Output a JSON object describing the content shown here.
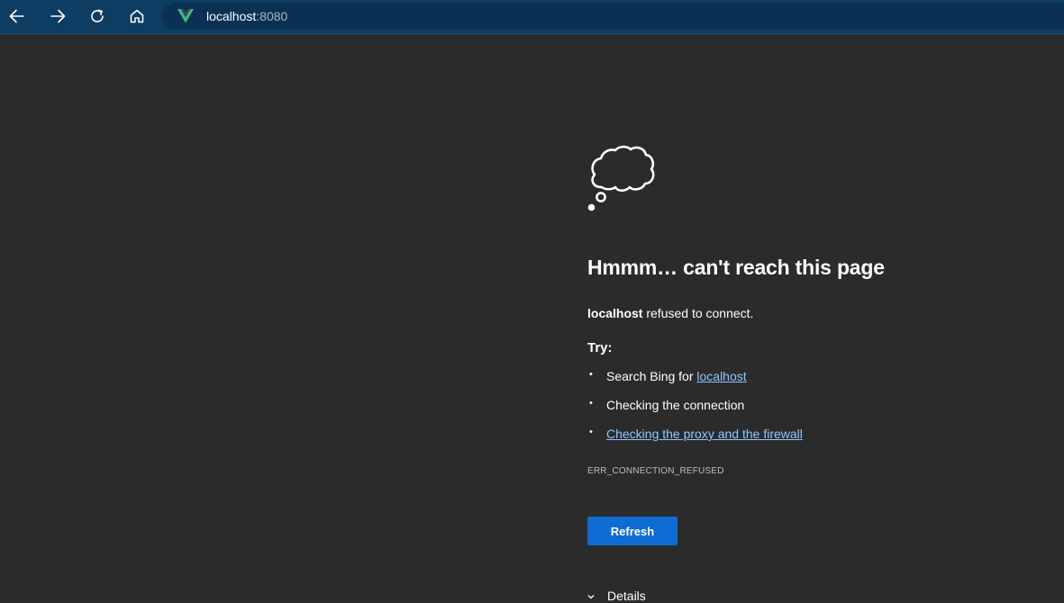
{
  "toolbar": {
    "back_icon": "arrow-left-icon",
    "forward_icon": "arrow-right-icon",
    "refresh_icon": "refresh-icon",
    "home_icon": "home-icon"
  },
  "address": {
    "host": "localhost",
    "port": ":8080",
    "site_icon": "vue-logo-icon"
  },
  "error_page": {
    "icon": "thought-cloud-icon",
    "headline": "Hmmm… can't reach this page",
    "host_bold": "localhost",
    "refused_text": " refused to connect.",
    "try_label": "Try:",
    "suggestions": {
      "bing_prefix": "Search Bing for ",
      "bing_link": "localhost",
      "check_connection": "Checking the connection",
      "check_proxy": "Checking the proxy and the firewall"
    },
    "error_code": "ERR_CONNECTION_REFUSED",
    "refresh_label": "Refresh",
    "details_label": "Details"
  },
  "colors": {
    "toolbar_bg": "#0e3d63",
    "page_bg": "#2b2b2b",
    "link": "#8cc8ff",
    "button_bg": "#0f6cd3",
    "vue_green": "#41b883"
  }
}
